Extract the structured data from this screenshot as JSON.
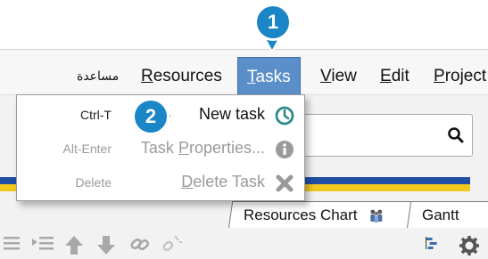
{
  "callouts": {
    "first": "1",
    "second": "2"
  },
  "menubar": {
    "help": "مساعدة",
    "resources": {
      "underlined": "R",
      "rest": "esources"
    },
    "tasks": {
      "underlined": "T",
      "rest": "asks"
    },
    "view": {
      "underlined": "V",
      "rest": "iew"
    },
    "edit": {
      "underlined": "E",
      "rest": "dit"
    },
    "project": {
      "underlined": "P",
      "rest": "roject"
    }
  },
  "tasks_menu": {
    "items": [
      {
        "shortcut": "Ctrl-T",
        "label_before": "",
        "label_underlined": "",
        "label_after": "New task",
        "icon": "clock-icon",
        "enabled": true
      },
      {
        "shortcut": "Alt-Enter",
        "label_before": "Task ",
        "label_underlined": "P",
        "label_after": "roperties...",
        "icon": "info-icon",
        "enabled": false
      },
      {
        "shortcut": "Delete",
        "label_before": "",
        "label_underlined": "D",
        "label_after": "elete Task",
        "icon": "delete-x-icon",
        "enabled": false
      }
    ]
  },
  "tabs": {
    "resources_chart": "Resources Chart",
    "gantt": "Gantt"
  },
  "colors": {
    "menu_active": "#5b8fc9",
    "callout": "#1a86c6",
    "stripe_blue": "#1f4ea3",
    "stripe_yellow": "#f2c81f",
    "clock_icon": "#2f8a8a"
  }
}
